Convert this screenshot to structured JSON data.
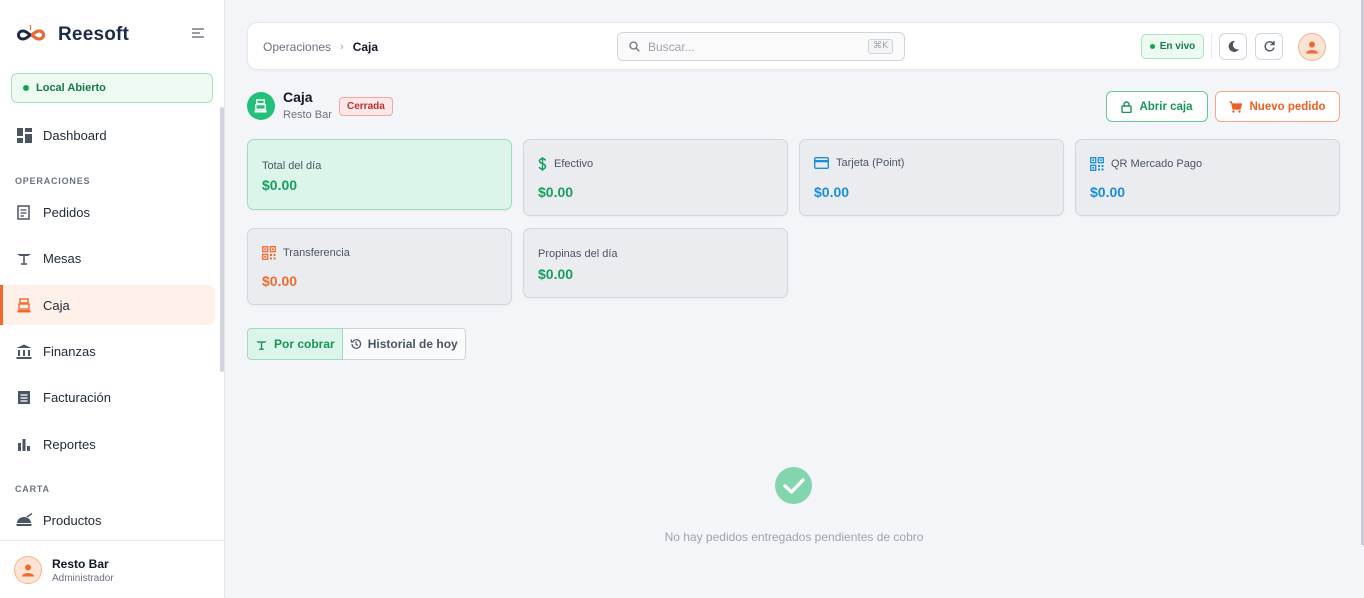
{
  "brand": {
    "name": "Reesoft"
  },
  "sidebar": {
    "local_status": "Local Abierto",
    "items": [
      {
        "label": "Dashboard",
        "icon": "dashboard-icon"
      },
      {
        "label": "Pedidos",
        "icon": "receipt-icon"
      },
      {
        "label": "Mesas",
        "icon": "table-icon"
      },
      {
        "label": "Caja",
        "icon": "cash-register-icon",
        "active": true
      },
      {
        "label": "Finanzas",
        "icon": "bank-icon"
      },
      {
        "label": "Facturación",
        "icon": "invoice-icon"
      },
      {
        "label": "Reportes",
        "icon": "bar-chart-icon"
      },
      {
        "label": "Productos",
        "icon": "dish-icon"
      }
    ],
    "sections": {
      "operaciones": "OPERACIONES",
      "carta": "CARTA"
    },
    "user": {
      "name": "Resto Bar",
      "role": "Administrador"
    }
  },
  "topbar": {
    "breadcrumb": {
      "parent": "Operaciones",
      "separator": "›",
      "current": "Caja"
    },
    "search": {
      "placeholder": "Buscar...",
      "shortcut": "⌘K"
    },
    "live": "En vivo"
  },
  "page": {
    "title": "Caja",
    "subtitle": "Resto Bar",
    "status": "Cerrada",
    "actions": {
      "open": "Abrir caja",
      "new_order": "Nuevo pedido"
    }
  },
  "cards": {
    "total": {
      "label": "Total del día",
      "value": "$0.00"
    },
    "efectivo": {
      "label": "Efectivo",
      "value": "$0.00",
      "icon": "dollar-icon"
    },
    "tarjeta": {
      "label": "Tarjeta (Point)",
      "value": "$0.00",
      "icon": "credit-card-icon"
    },
    "qr": {
      "label": "QR Mercado Pago",
      "value": "$0.00",
      "icon": "qr-code-icon"
    },
    "transferencia": {
      "label": "Transferencia",
      "value": "$0.00",
      "icon": "qr-code-icon"
    },
    "propinas": {
      "label": "Propinas del día",
      "value": "$0.00"
    }
  },
  "tabs": [
    {
      "label": "Por cobrar",
      "active": true,
      "icon": "table-icon"
    },
    {
      "label": "Historial de hoy",
      "active": false,
      "icon": "history-icon"
    }
  ],
  "empty_state": {
    "message": "No hay pedidos entregados pendientes de cobro",
    "icon": "check-circle-icon"
  },
  "colors": {
    "accent": "#f06a2f",
    "success": "#16a060",
    "info": "#1a8fd8",
    "danger": "#c22d2d"
  }
}
